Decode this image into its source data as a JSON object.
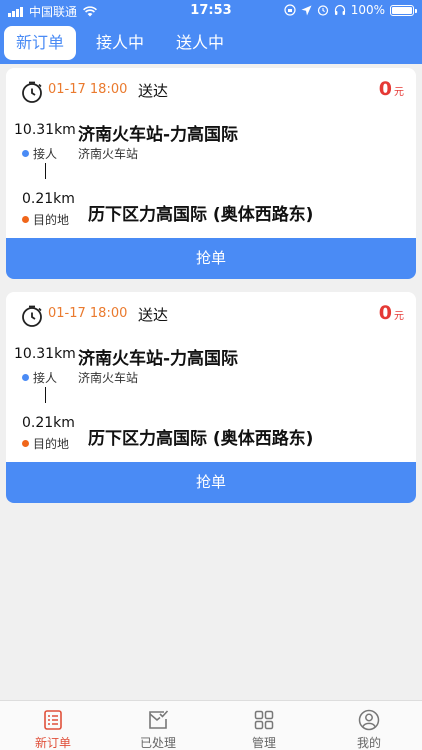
{
  "status_bar": {
    "carrier": "中国联通",
    "time": "17:53",
    "battery": "100%"
  },
  "tabs": [
    {
      "label": "新订单",
      "active": true
    },
    {
      "label": "接人中",
      "active": false
    },
    {
      "label": "送人中",
      "active": false
    }
  ],
  "orders": [
    {
      "time": "01-17 18:00",
      "type": "送达",
      "price": "0",
      "price_unit": "元",
      "distance_pickup": "10.31km",
      "from_title": "济南火车站-力高国际",
      "pickup_label": "接人",
      "from_sub": "济南火车站",
      "distance_dest": "0.21km",
      "dest_label": "目的地",
      "to_title": "历下区力高国际 (奥体西路东)",
      "button": "抢单"
    },
    {
      "time": "01-17 18:00",
      "type": "送达",
      "price": "0",
      "price_unit": "元",
      "distance_pickup": "10.31km",
      "from_title": "济南火车站-力高国际",
      "pickup_label": "接人",
      "from_sub": "济南火车站",
      "distance_dest": "0.21km",
      "dest_label": "目的地",
      "to_title": "历下区力高国际 (奥体西路东)",
      "button": "抢单"
    }
  ],
  "bottom_nav": [
    {
      "label": "新订单",
      "icon": "list-icon",
      "active": true
    },
    {
      "label": "已处理",
      "icon": "mail-check-icon",
      "active": false
    },
    {
      "label": "管理",
      "icon": "grid-icon",
      "active": false
    },
    {
      "label": "我的",
      "icon": "user-icon",
      "active": false
    }
  ],
  "colors": {
    "primary": "#4a8bf5",
    "time": "#ea7a2e",
    "price": "#e53935",
    "nav_active": "#e0503a"
  }
}
